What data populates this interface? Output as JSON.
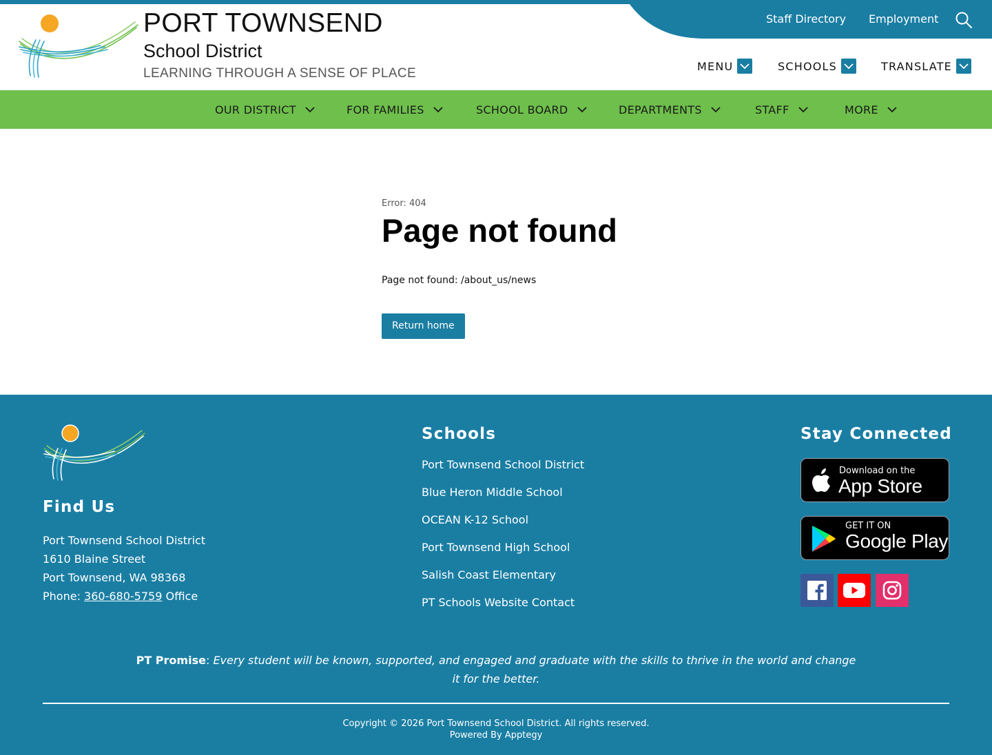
{
  "header": {
    "title_main": "PORT TOWNSEND",
    "title_sub": "School District",
    "tagline": "LEARNING THROUGH A SENSE OF PLACE",
    "utility_links": [
      "Staff Directory",
      "Employment"
    ],
    "dropdowns": [
      "MENU",
      "SCHOOLS",
      "TRANSLATE"
    ]
  },
  "nav": {
    "items": [
      "OUR DISTRICT",
      "FOR FAMILIES",
      "SCHOOL BOARD",
      "DEPARTMENTS",
      "STAFF",
      "MORE"
    ]
  },
  "main": {
    "error_code": "Error: 404",
    "title": "Page not found",
    "message": "Page not found: /about_us/news",
    "return_label": "Return home"
  },
  "footer": {
    "find_us_heading": "Find Us",
    "address": {
      "name": "Port Townsend School District",
      "street": "1610 Blaine Street",
      "city": "Port Townsend, WA 98368",
      "phone_label": "Phone: ",
      "phone": "360-680-5759",
      "phone_suffix": " Office"
    },
    "schools_heading": "Schools",
    "schools": [
      "Port Townsend School District",
      "Blue Heron Middle School",
      "OCEAN K-12 School",
      "Port Townsend High School",
      "Salish Coast Elementary",
      "PT Schools Website Contact"
    ],
    "stay_heading": "Stay Connected",
    "app_store": {
      "small": "Download on the",
      "big": "App Store"
    },
    "google_play": {
      "small": "GET IT ON",
      "big": "Google Play"
    },
    "promise_label": "PT Promise",
    "promise_sep": ": ",
    "promise_text": "Every student will be known, supported, and engaged and graduate with the skills to thrive in the world and change it for the better.",
    "copyright": "Copyright © 2026 Port Townsend School District. All rights reserved.",
    "powered_by": "Powered By Apptegy"
  },
  "colors": {
    "primary_blue": "#1a7ea3",
    "nav_green": "#6ebf4b",
    "sun_yellow": "#f5a623",
    "facebook": "#3b5998",
    "youtube": "#ff0000",
    "instagram": "#e1306c"
  },
  "icons": {
    "search": "search-icon",
    "dropdown": "chevron-down-icon",
    "facebook": "facebook-icon",
    "youtube": "youtube-icon",
    "instagram": "instagram-icon",
    "apple": "apple-icon",
    "google_play": "google-play-icon"
  }
}
